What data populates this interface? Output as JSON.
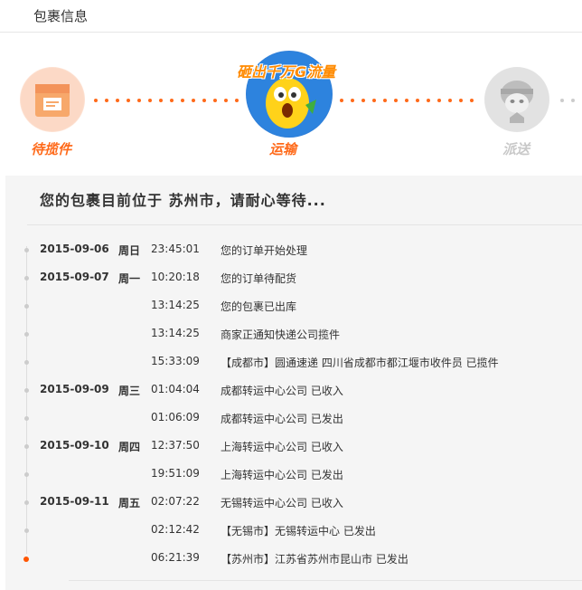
{
  "header": {
    "title": "包裹信息"
  },
  "steps": [
    {
      "label": "待揽件",
      "icon": "package-icon",
      "state": "done",
      "color": "#ff6a1a"
    },
    {
      "label": "运输",
      "icon": "mascot-icon",
      "state": "current",
      "color": "#ff6a1a",
      "banner": "砸出千万G流量"
    },
    {
      "label": "派送",
      "icon": "courier-icon",
      "state": "pending",
      "color": "#c8c8c8"
    }
  ],
  "status": {
    "location_text": "您的包裹目前位于 苏州市，请耐心等待..."
  },
  "timeline": [
    {
      "date": "2015-09-06",
      "weekday": "周日",
      "time": "23:45:01",
      "desc": "您的订单开始处理"
    },
    {
      "date": "2015-09-07",
      "weekday": "周一",
      "time": "10:20:18",
      "desc": "您的订单待配货"
    },
    {
      "date": "",
      "weekday": "",
      "time": "13:14:25",
      "desc": "您的包裹已出库"
    },
    {
      "date": "",
      "weekday": "",
      "time": "13:14:25",
      "desc": "商家正通知快递公司揽件"
    },
    {
      "date": "",
      "weekday": "",
      "time": "15:33:09",
      "desc": "【成都市】圆通速递 四川省成都市都江堰市收件员 已揽件"
    },
    {
      "date": "2015-09-09",
      "weekday": "周三",
      "time": "01:04:04",
      "desc": "成都转运中心公司 已收入"
    },
    {
      "date": "",
      "weekday": "",
      "time": "01:06:09",
      "desc": "成都转运中心公司 已发出"
    },
    {
      "date": "2015-09-10",
      "weekday": "周四",
      "time": "12:37:50",
      "desc": "上海转运中心公司 已收入"
    },
    {
      "date": "",
      "weekday": "",
      "time": "19:51:09",
      "desc": "上海转运中心公司 已发出"
    },
    {
      "date": "2015-09-11",
      "weekday": "周五",
      "time": "02:07:22",
      "desc": "无锡转运中心公司 已收入"
    },
    {
      "date": "",
      "weekday": "",
      "time": "02:12:42",
      "desc": "【无锡市】无锡转运中心 已发出"
    },
    {
      "date": "",
      "weekday": "",
      "time": "06:21:39",
      "desc": "【苏州市】江苏省苏州市昆山市 已发出"
    }
  ],
  "colors": {
    "accent": "#ff6a1a",
    "pending": "#c8c8c8",
    "active_dot": "#ff5500"
  }
}
